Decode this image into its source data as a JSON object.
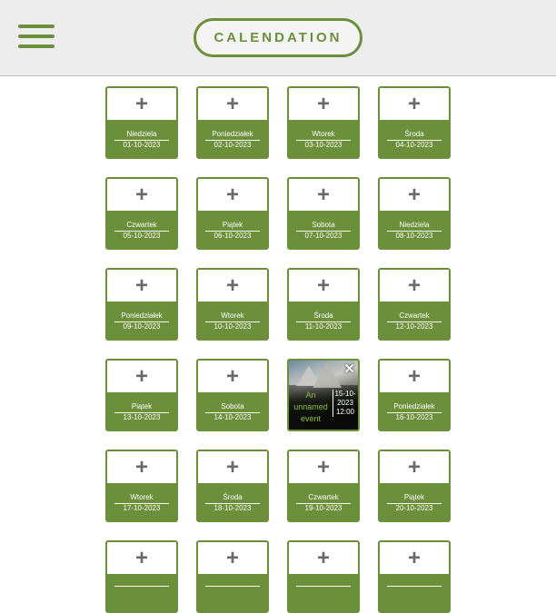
{
  "header": {
    "app_title": "CALENDATION"
  },
  "days": [
    {
      "name": "Niedziela",
      "date": "01-10-2023",
      "add": "+"
    },
    {
      "name": "Poniedziałek",
      "date": "02-10-2023",
      "add": "+"
    },
    {
      "name": "Wtorek",
      "date": "03-10-2023",
      "add": "+"
    },
    {
      "name": "Środa",
      "date": "04-10-2023",
      "add": "+"
    },
    {
      "name": "Czwartek",
      "date": "05-10-2023",
      "add": "+"
    },
    {
      "name": "Piątek",
      "date": "06-10-2023",
      "add": "+"
    },
    {
      "name": "Sobota",
      "date": "07-10-2023",
      "add": "+"
    },
    {
      "name": "Niedziela",
      "date": "08-10-2023",
      "add": "+"
    },
    {
      "name": "Poniedziałek",
      "date": "09-10-2023",
      "add": "+"
    },
    {
      "name": "Wtorek",
      "date": "10-10-2023",
      "add": "+"
    },
    {
      "name": "Środa",
      "date": "11-10-2023",
      "add": "+"
    },
    {
      "name": "Czwartek",
      "date": "12-10-2023",
      "add": "+"
    },
    {
      "name": "Piątek",
      "date": "13-10-2023",
      "add": "+"
    },
    {
      "name": "Sobota",
      "date": "14-10-2023",
      "add": "+"
    },
    {
      "name": "Poniedziałek",
      "date": "16-10-2023",
      "add": "+"
    },
    {
      "name": "Wtorek",
      "date": "17-10-2023",
      "add": "+"
    },
    {
      "name": "Środa",
      "date": "18-10-2023",
      "add": "+"
    },
    {
      "name": "Czwartek",
      "date": "19-10-2023",
      "add": "+"
    },
    {
      "name": "Piątek",
      "date": "20-10-2023",
      "add": "+"
    },
    {
      "name": "",
      "date": "",
      "add": "+"
    },
    {
      "name": "",
      "date": "",
      "add": "+"
    },
    {
      "name": "",
      "date": "",
      "add": "+"
    },
    {
      "name": "",
      "date": "",
      "add": "+"
    }
  ],
  "event": {
    "name": "An unnamed event",
    "date": "15-10-2023",
    "time": "12:00",
    "close": "✕"
  },
  "colors": {
    "accent": "#6b8f3a",
    "header_bg": "#ededed",
    "plus_gray": "#6a6a6a",
    "event_text": "#8fbf45"
  },
  "icons": {
    "menu": "hamburger-menu-icon",
    "add": "plus-icon",
    "close": "close-icon"
  }
}
